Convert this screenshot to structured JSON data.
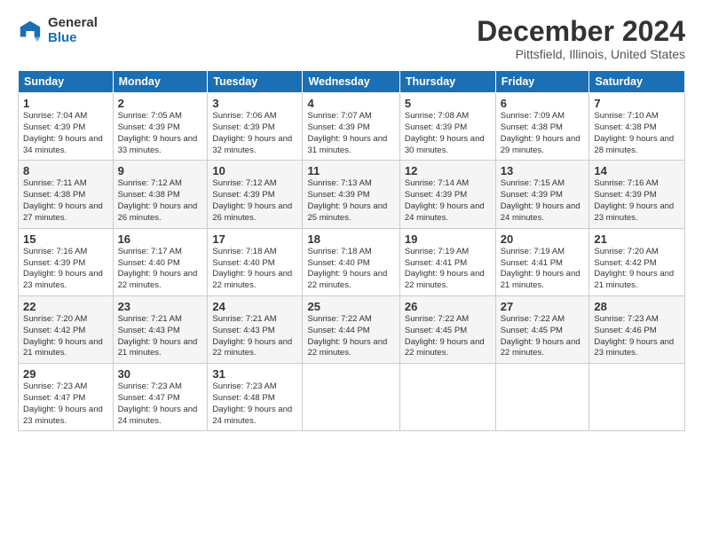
{
  "header": {
    "logo_general": "General",
    "logo_blue": "Blue",
    "title": "December 2024",
    "location": "Pittsfield, Illinois, United States"
  },
  "days_of_week": [
    "Sunday",
    "Monday",
    "Tuesday",
    "Wednesday",
    "Thursday",
    "Friday",
    "Saturday"
  ],
  "weeks": [
    [
      {
        "day": "1",
        "sunrise": "7:04 AM",
        "sunset": "4:39 PM",
        "daylight": "9 hours and 34 minutes."
      },
      {
        "day": "2",
        "sunrise": "7:05 AM",
        "sunset": "4:39 PM",
        "daylight": "9 hours and 33 minutes."
      },
      {
        "day": "3",
        "sunrise": "7:06 AM",
        "sunset": "4:39 PM",
        "daylight": "9 hours and 32 minutes."
      },
      {
        "day": "4",
        "sunrise": "7:07 AM",
        "sunset": "4:39 PM",
        "daylight": "9 hours and 31 minutes."
      },
      {
        "day": "5",
        "sunrise": "7:08 AM",
        "sunset": "4:39 PM",
        "daylight": "9 hours and 30 minutes."
      },
      {
        "day": "6",
        "sunrise": "7:09 AM",
        "sunset": "4:38 PM",
        "daylight": "9 hours and 29 minutes."
      },
      {
        "day": "7",
        "sunrise": "7:10 AM",
        "sunset": "4:38 PM",
        "daylight": "9 hours and 28 minutes."
      }
    ],
    [
      {
        "day": "8",
        "sunrise": "7:11 AM",
        "sunset": "4:38 PM",
        "daylight": "9 hours and 27 minutes."
      },
      {
        "day": "9",
        "sunrise": "7:12 AM",
        "sunset": "4:38 PM",
        "daylight": "9 hours and 26 minutes."
      },
      {
        "day": "10",
        "sunrise": "7:12 AM",
        "sunset": "4:39 PM",
        "daylight": "9 hours and 26 minutes."
      },
      {
        "day": "11",
        "sunrise": "7:13 AM",
        "sunset": "4:39 PM",
        "daylight": "9 hours and 25 minutes."
      },
      {
        "day": "12",
        "sunrise": "7:14 AM",
        "sunset": "4:39 PM",
        "daylight": "9 hours and 24 minutes."
      },
      {
        "day": "13",
        "sunrise": "7:15 AM",
        "sunset": "4:39 PM",
        "daylight": "9 hours and 24 minutes."
      },
      {
        "day": "14",
        "sunrise": "7:16 AM",
        "sunset": "4:39 PM",
        "daylight": "9 hours and 23 minutes."
      }
    ],
    [
      {
        "day": "15",
        "sunrise": "7:16 AM",
        "sunset": "4:39 PM",
        "daylight": "9 hours and 23 minutes."
      },
      {
        "day": "16",
        "sunrise": "7:17 AM",
        "sunset": "4:40 PM",
        "daylight": "9 hours and 22 minutes."
      },
      {
        "day": "17",
        "sunrise": "7:18 AM",
        "sunset": "4:40 PM",
        "daylight": "9 hours and 22 minutes."
      },
      {
        "day": "18",
        "sunrise": "7:18 AM",
        "sunset": "4:40 PM",
        "daylight": "9 hours and 22 minutes."
      },
      {
        "day": "19",
        "sunrise": "7:19 AM",
        "sunset": "4:41 PM",
        "daylight": "9 hours and 22 minutes."
      },
      {
        "day": "20",
        "sunrise": "7:19 AM",
        "sunset": "4:41 PM",
        "daylight": "9 hours and 21 minutes."
      },
      {
        "day": "21",
        "sunrise": "7:20 AM",
        "sunset": "4:42 PM",
        "daylight": "9 hours and 21 minutes."
      }
    ],
    [
      {
        "day": "22",
        "sunrise": "7:20 AM",
        "sunset": "4:42 PM",
        "daylight": "9 hours and 21 minutes."
      },
      {
        "day": "23",
        "sunrise": "7:21 AM",
        "sunset": "4:43 PM",
        "daylight": "9 hours and 21 minutes."
      },
      {
        "day": "24",
        "sunrise": "7:21 AM",
        "sunset": "4:43 PM",
        "daylight": "9 hours and 22 minutes."
      },
      {
        "day": "25",
        "sunrise": "7:22 AM",
        "sunset": "4:44 PM",
        "daylight": "9 hours and 22 minutes."
      },
      {
        "day": "26",
        "sunrise": "7:22 AM",
        "sunset": "4:45 PM",
        "daylight": "9 hours and 22 minutes."
      },
      {
        "day": "27",
        "sunrise": "7:22 AM",
        "sunset": "4:45 PM",
        "daylight": "9 hours and 22 minutes."
      },
      {
        "day": "28",
        "sunrise": "7:23 AM",
        "sunset": "4:46 PM",
        "daylight": "9 hours and 23 minutes."
      }
    ],
    [
      {
        "day": "29",
        "sunrise": "7:23 AM",
        "sunset": "4:47 PM",
        "daylight": "9 hours and 23 minutes."
      },
      {
        "day": "30",
        "sunrise": "7:23 AM",
        "sunset": "4:47 PM",
        "daylight": "9 hours and 24 minutes."
      },
      {
        "day": "31",
        "sunrise": "7:23 AM",
        "sunset": "4:48 PM",
        "daylight": "9 hours and 24 minutes."
      },
      null,
      null,
      null,
      null
    ]
  ]
}
